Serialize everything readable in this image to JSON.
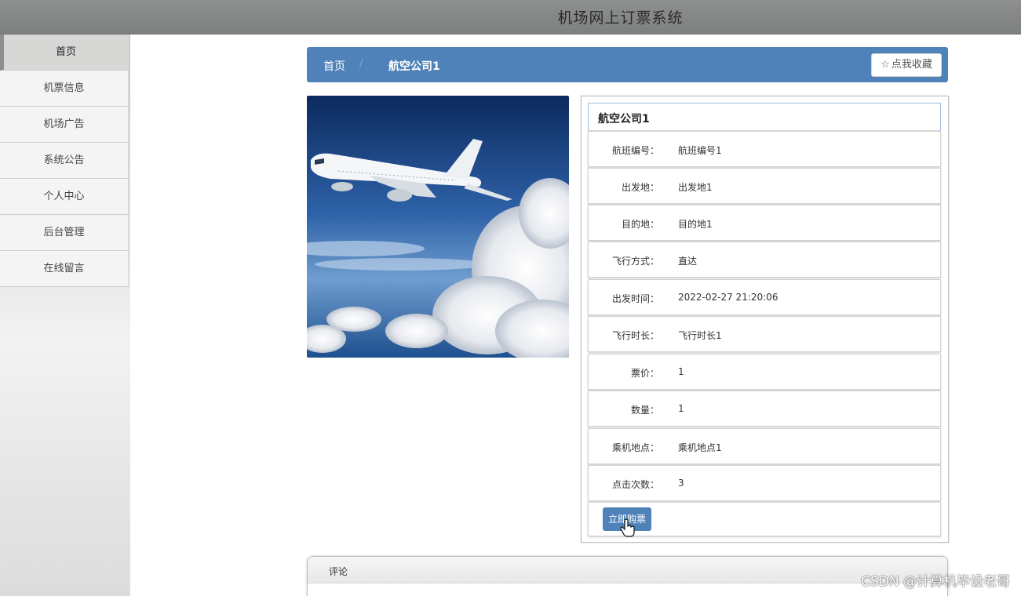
{
  "app": {
    "title": "机场网上订票系统"
  },
  "sidebar": {
    "items": [
      {
        "label": "首页"
      },
      {
        "label": "机票信息"
      },
      {
        "label": "机场广告"
      },
      {
        "label": "系统公告"
      },
      {
        "label": "个人中心"
      },
      {
        "label": "后台管理"
      },
      {
        "label": "在线留言"
      }
    ]
  },
  "breadcrumb": {
    "home": "首页",
    "separator": "/",
    "current": "航空公司1"
  },
  "favorite": {
    "icon": "star-outline-icon",
    "label": "点我收藏"
  },
  "detail": {
    "title": "航空公司1",
    "rows": [
      {
        "label": "航班编号：",
        "value": "航班编号1"
      },
      {
        "label": "出发地：",
        "value": "出发地1"
      },
      {
        "label": "目的地：",
        "value": "目的地1"
      },
      {
        "label": "飞行方式：",
        "value": "直达"
      },
      {
        "label": "出发时间：",
        "value": "2022-02-27 21:20:06"
      },
      {
        "label": "飞行时长：",
        "value": "飞行时长1"
      },
      {
        "label": "票价：",
        "value": "1"
      },
      {
        "label": "数量：",
        "value": "1"
      },
      {
        "label": "乘机地点：",
        "value": "乘机地点1"
      },
      {
        "label": "点击次数：",
        "value": "3"
      }
    ],
    "buy_label": "立即购票"
  },
  "comments": {
    "title": "评论"
  },
  "watermark": "CSDN @计算机毕设老哥",
  "colors": {
    "accent": "#4f82b8",
    "topbar": "#858886"
  }
}
